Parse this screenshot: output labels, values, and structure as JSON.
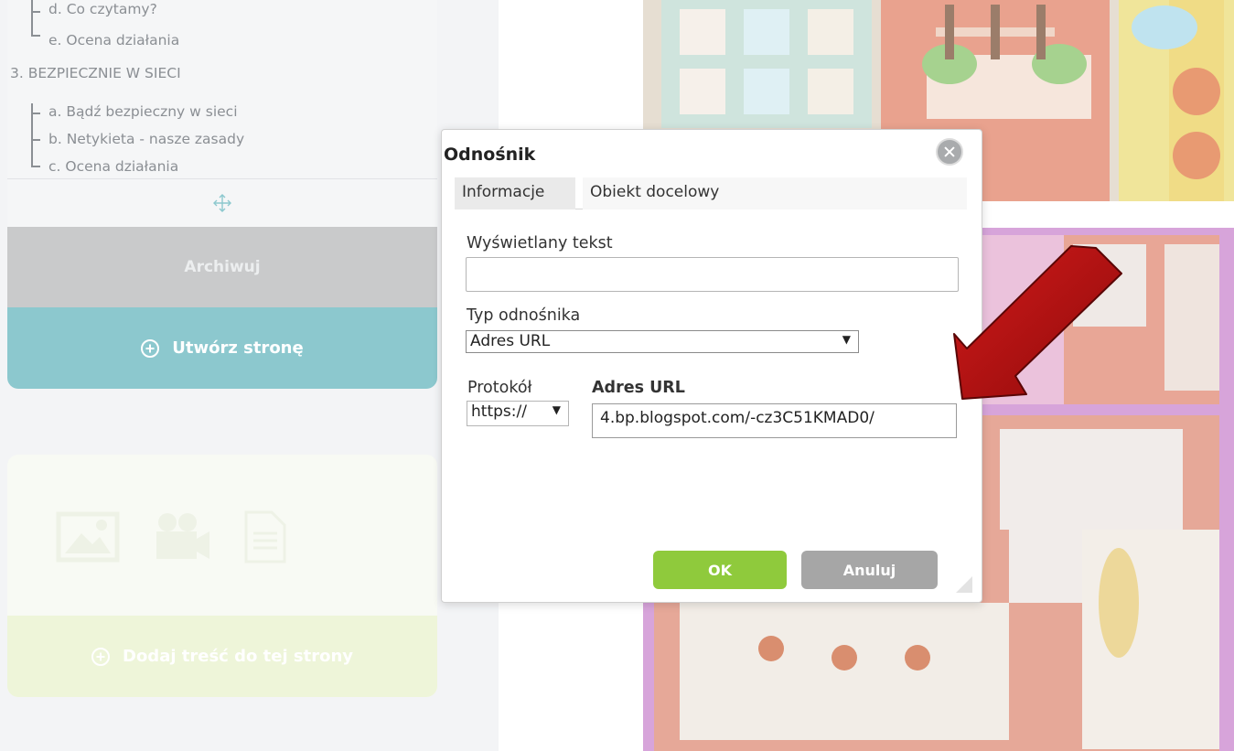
{
  "sidebar": {
    "nav_items": {
      "d": "d. Co czytamy?",
      "e": "e. Ocena działania",
      "section3": "3. BEZPIECZNIE W SIECI",
      "a": "a. Bądź bezpieczny w sieci",
      "b": "b. Netykieta - nasze zasady",
      "c": "c. Ocena działania"
    },
    "archive_label": "Archiwuj",
    "create_page_label": "Utwórz stronę",
    "add_content_label": "Dodaj treść do tej strony"
  },
  "dialog": {
    "title": "Odnośnik",
    "tabs": [
      "Informacje",
      "Obiekt docelowy"
    ],
    "display_text_label": "Wyświetlany tekst",
    "display_text_value": "",
    "link_type_label": "Typ odnośnika",
    "link_type_value": "Adres URL",
    "protocol_label": "Protokół",
    "protocol_value": "https://",
    "url_label": "Adres URL",
    "url_value": "4.bp.blogspot.com/-cz3C51KMAD0/",
    "ok_label": "OK",
    "cancel_label": "Anuluj"
  },
  "colors": {
    "create_button": "#8cc8ce",
    "archive_button": "#c9cacb",
    "ok_button": "#8fca3c",
    "cancel_button": "#a6a6a6",
    "arrow": "#b50f0f"
  },
  "icons": [
    "move-icon",
    "image-icon",
    "video-icon",
    "document-icon",
    "close-icon",
    "plus-circle-icon",
    "resize-handle-icon"
  ]
}
